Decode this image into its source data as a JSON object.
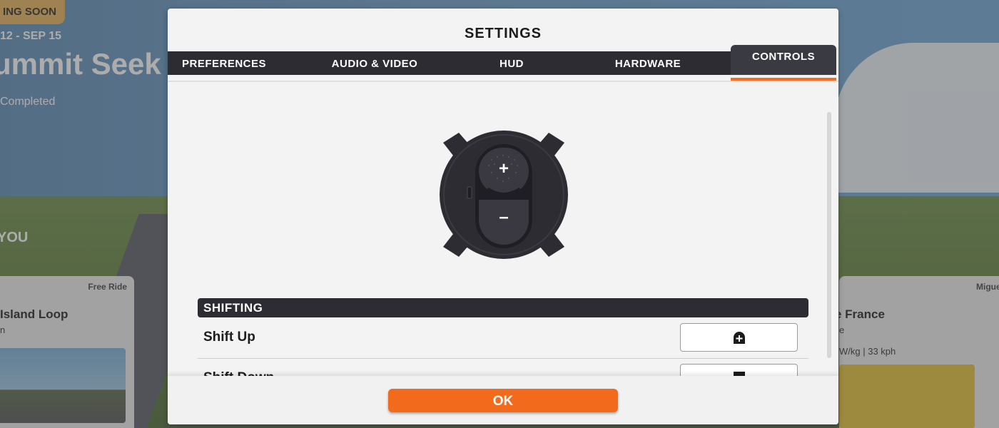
{
  "background": {
    "badge": "ING SOON",
    "date": "12 - SEP 15",
    "event_title": "ummit Seek",
    "status": "Completed",
    "section_label": "YOU",
    "left_card": {
      "tag": "Free Ride",
      "name": "Island Loop",
      "sub": "n"
    },
    "right_card": {
      "tag": "Miguel",
      "name": "e France",
      "sub": "e",
      "stats": "W/kg | 33 kph"
    }
  },
  "modal": {
    "title": "SETTINGS",
    "tabs": [
      {
        "label": "PREFERENCES",
        "active": false
      },
      {
        "label": "AUDIO & VIDEO",
        "active": false
      },
      {
        "label": "HUD",
        "active": false
      },
      {
        "label": "HARDWARE",
        "active": false
      },
      {
        "label": "CONTROLS",
        "active": true
      }
    ],
    "controller": {
      "plus_symbol": "+",
      "minus_symbol": "–"
    },
    "section": {
      "title": "SHIFTING",
      "rows": [
        {
          "label": "Shift Up",
          "binding_icon": "plus-button-icon"
        },
        {
          "label": "Shift Down",
          "binding_icon": "minus-button-icon"
        }
      ]
    },
    "ok_label": "OK"
  },
  "colors": {
    "accent": "#f26b1d",
    "tab_bar": "#2d2c32",
    "modal_bg": "#f3f3f3"
  }
}
